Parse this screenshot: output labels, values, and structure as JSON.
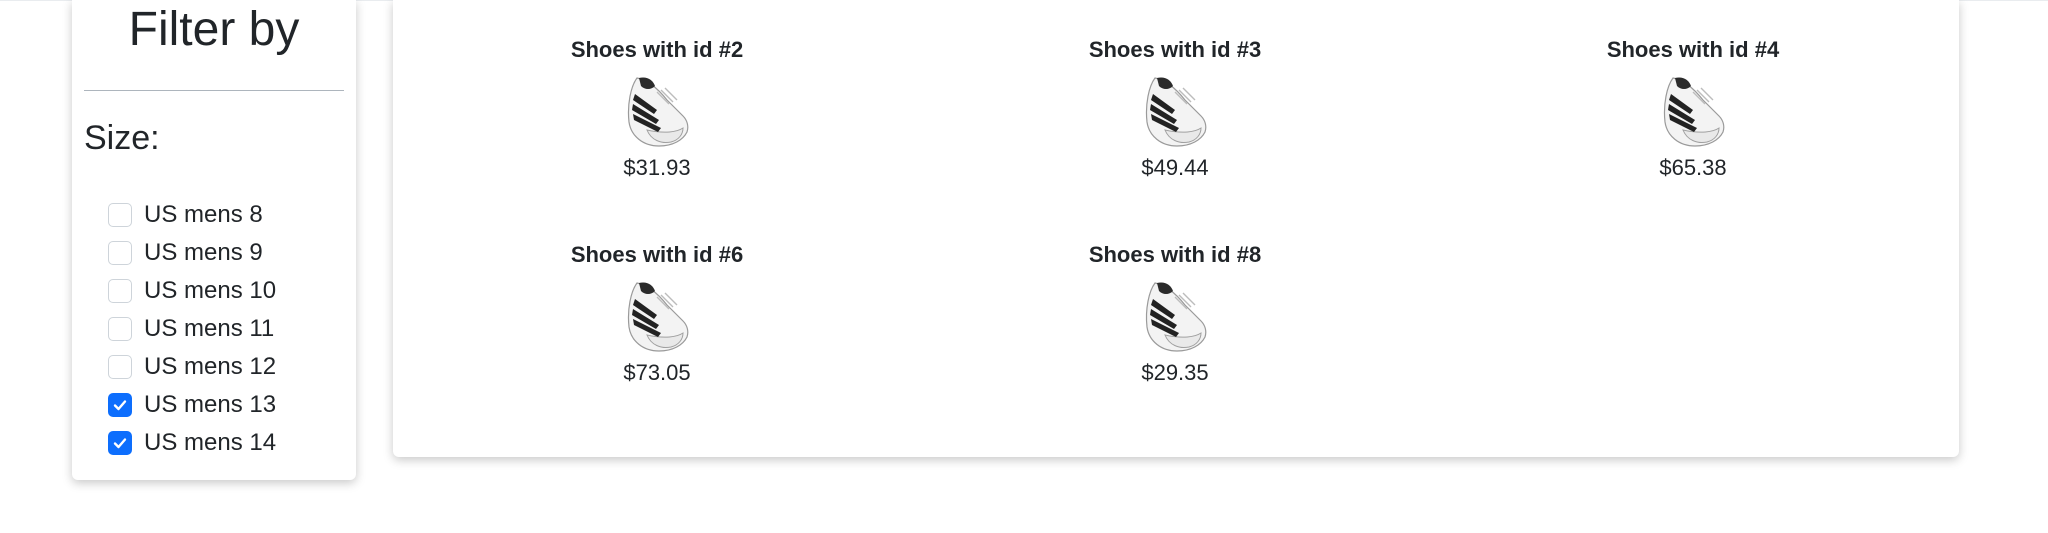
{
  "filter": {
    "title": "Filter by",
    "size_heading": "Size:",
    "sizes": [
      {
        "label": "US mens 8",
        "checked": false
      },
      {
        "label": "US mens 9",
        "checked": false
      },
      {
        "label": "US mens 10",
        "checked": false
      },
      {
        "label": "US mens 11",
        "checked": false
      },
      {
        "label": "US mens 12",
        "checked": false
      },
      {
        "label": "US mens 13",
        "checked": true
      },
      {
        "label": "US mens 14",
        "checked": true
      }
    ]
  },
  "products": [
    {
      "name": "Shoes with id #2",
      "price": "$31.93"
    },
    {
      "name": "Shoes with id #3",
      "price": "$49.44"
    },
    {
      "name": "Shoes with id #4",
      "price": "$65.38"
    },
    {
      "name": "Shoes with id #6",
      "price": "$73.05"
    },
    {
      "name": "Shoes with id #8",
      "price": "$29.35"
    }
  ],
  "colors": {
    "accent": "#0d6efd",
    "text": "#212529",
    "checkbox_border": "#ced4da"
  }
}
